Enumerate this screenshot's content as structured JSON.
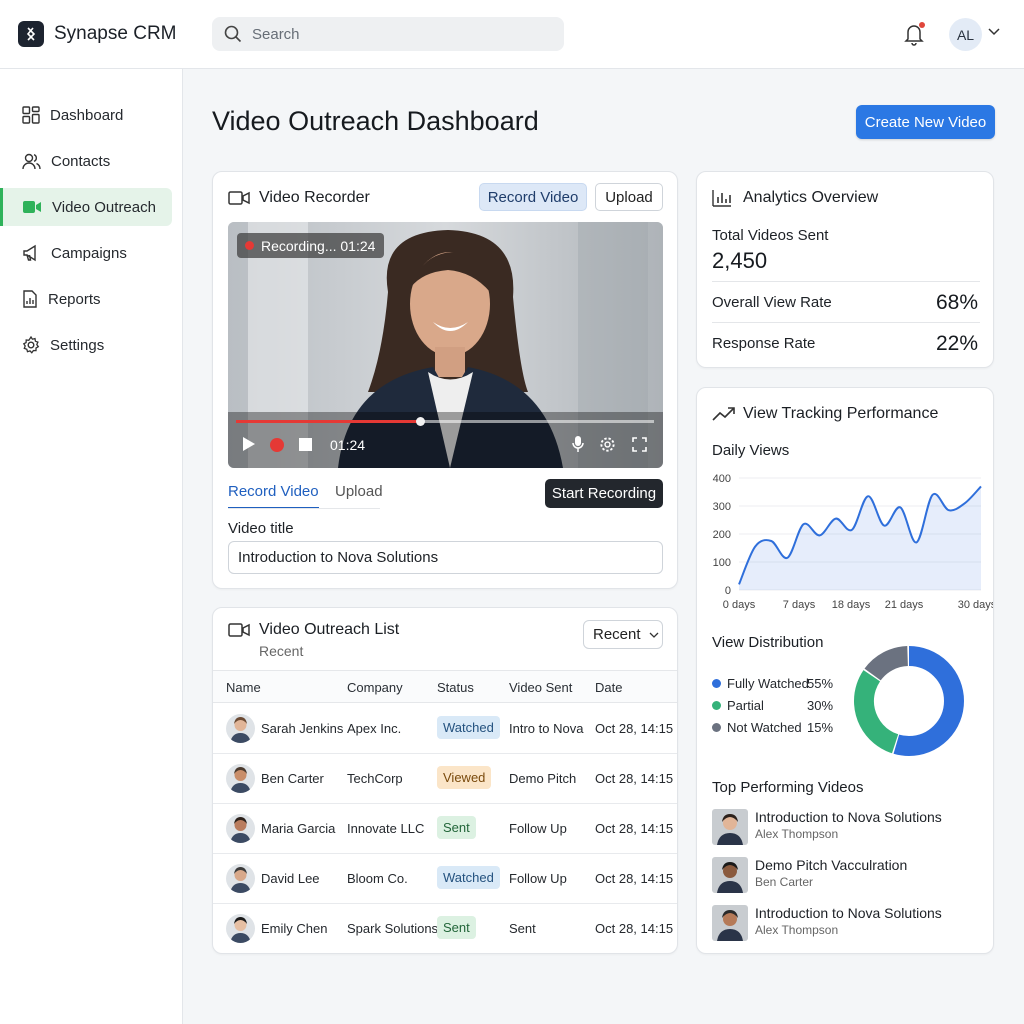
{
  "app": {
    "name": "Synapse CRM",
    "user_initials": "AL"
  },
  "search": {
    "placeholder": "Search"
  },
  "sidebar": {
    "items": [
      {
        "label": "Dashboard",
        "icon": "grid-icon"
      },
      {
        "label": "Contacts",
        "icon": "users-icon"
      },
      {
        "label": "Video Outreach",
        "icon": "video-icon",
        "active": true
      },
      {
        "label": "Campaigns",
        "icon": "megaphone-icon"
      },
      {
        "label": "Reports",
        "icon": "report-icon"
      },
      {
        "label": "Settings",
        "icon": "gear-icon"
      }
    ]
  },
  "page": {
    "title": "Video Outreach Dashboard",
    "create_button": "Create New Video"
  },
  "recorder": {
    "title": "Video Recorder",
    "record_button": "Record Video",
    "upload_button": "Upload",
    "recording_badge": "Recording... 01:24",
    "time": "01:24",
    "progress": 0.44,
    "tabs": [
      "Record Video",
      "Upload"
    ],
    "start_button": "Start Recording",
    "title_label": "Video title",
    "title_value": "Introduction to Nova Solutions"
  },
  "list": {
    "title": "Video Outreach List",
    "subtitle": "Recent",
    "sort_value": "Recent",
    "columns": [
      "Name",
      "Company",
      "Status",
      "Video Sent",
      "Date"
    ],
    "rows": [
      {
        "name": "Sarah Jenkins",
        "company": "Apex Inc.",
        "status": "Watched",
        "video": "Intro to Nova",
        "date": "Oct 28, 14:15"
      },
      {
        "name": "Ben Carter",
        "company": "TechCorp",
        "status": "Viewed",
        "video": "Demo Pitch",
        "date": "Oct 28, 14:15"
      },
      {
        "name": "Maria Garcia",
        "company": "Innovate LLC",
        "status": "Sent",
        "video": "Follow Up",
        "date": "Oct 28, 14:15"
      },
      {
        "name": "David Lee",
        "company": "Bloom Co.",
        "status": "Watched",
        "video": "Follow Up",
        "date": "Oct 28, 14:15"
      },
      {
        "name": "Emily Chen",
        "company": "Spark Solutions",
        "status": "Sent",
        "video": "Sent",
        "date": "Oct 28, 14:15"
      }
    ]
  },
  "analytics": {
    "title": "Analytics Overview",
    "total_label": "Total Videos Sent",
    "total_value": "2,450",
    "view_rate_label": "Overall View Rate",
    "view_rate_value": "68%",
    "response_label": "Response Rate",
    "response_value": "22%"
  },
  "tracking": {
    "title": "View Tracking Performance",
    "daily_label": "Daily Views",
    "distribution_label": "View Distribution",
    "distribution": [
      {
        "label": "Fully Watched",
        "pct": "55%",
        "value": 55,
        "color": "#2f6fdb"
      },
      {
        "label": "Partial",
        "pct": "30%",
        "value": 30,
        "color": "#35b27a"
      },
      {
        "label": "Not Watched",
        "pct": "15%",
        "value": 15,
        "color": "#6b7280"
      }
    ],
    "top_label": "Top Performing Videos",
    "top_videos": [
      {
        "title": "Introduction to Nova Solutions",
        "author": "Alex Thompson"
      },
      {
        "title": "Demo Pitch Vacculration",
        "author": "Ben Carter"
      },
      {
        "title": "Introduction to Nova Solutions",
        "author": "Alex Thompson"
      }
    ]
  },
  "chart_data": {
    "type": "area",
    "x": [
      0,
      2,
      4,
      6,
      8,
      10,
      12,
      14,
      16,
      18,
      20,
      22,
      24,
      26,
      28,
      30
    ],
    "values": [
      20,
      155,
      175,
      115,
      235,
      195,
      255,
      215,
      335,
      230,
      295,
      170,
      340,
      285,
      310,
      370
    ],
    "xticks": [
      "0 days",
      "7 days",
      "18 days",
      "21 days",
      "30 days"
    ],
    "yticks": [
      "0",
      "100",
      "200",
      "300",
      "400"
    ],
    "ylim": [
      0,
      400
    ],
    "xlim": [
      0,
      30
    ],
    "color": "#2f6fdb"
  },
  "colors": {
    "accent": "#2b78e4",
    "active_green": "#2fb25a",
    "record_red": "#e53935"
  }
}
